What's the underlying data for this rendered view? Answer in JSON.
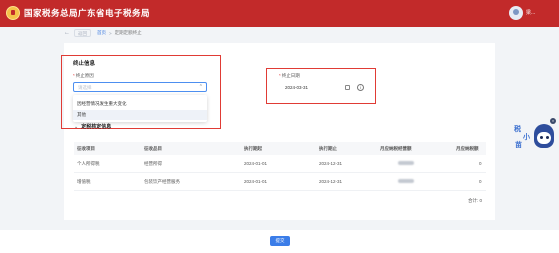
{
  "header": {
    "site_title": "国家税务总局广东省电子税务局",
    "user_name": "梁..."
  },
  "breadcrumb": {
    "back_label": "返回",
    "home": "首页",
    "separator": ">",
    "current": "定期定额终止"
  },
  "form": {
    "section_title": "终止信息",
    "reason": {
      "label": "终止原因",
      "placeholder": "请选择",
      "options": [
        "因经营情况发生重大变化",
        "其他"
      ]
    },
    "date": {
      "label": "终止日期",
      "value": "2024-03-31"
    }
  },
  "table": {
    "section_title": "定税核定信息",
    "headers": [
      "征收项目",
      "征收品目",
      "执行期起",
      "执行期止",
      "月应纳税经营额",
      "月应纳税额"
    ],
    "rows": [
      [
        "个人所得税",
        "经营所得",
        "2024-01-01",
        "2024-12-31",
        "",
        "0"
      ],
      [
        "增值税",
        "包装饮产经营服务",
        "2024-01-01",
        "2024-12-31",
        "",
        "0"
      ]
    ],
    "total_label": "合计: 0"
  },
  "mascot": {
    "chars": [
      "税",
      "小",
      "苗"
    ]
  },
  "footer": {
    "submit_label": "提交"
  },
  "colors": {
    "header_red": "#c22a2a",
    "primary_blue": "#3b7de8",
    "highlight_red": "#e03b35"
  }
}
